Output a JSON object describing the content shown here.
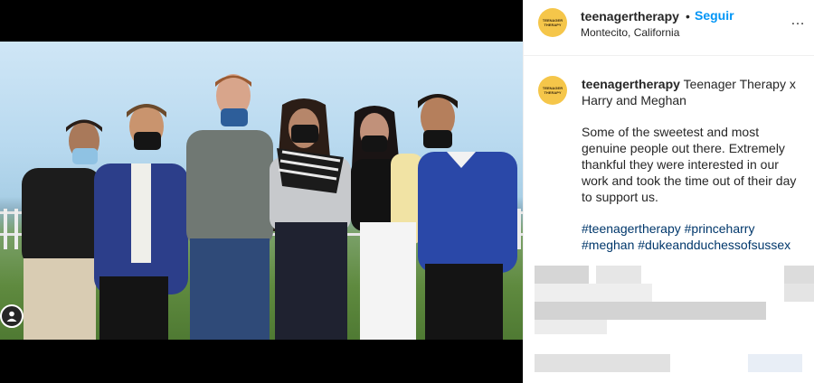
{
  "post": {
    "username": "teenagertherapy",
    "follow_separator": "•",
    "follow_label": "Seguir",
    "location": "Montecito, California",
    "more_icon": "…"
  },
  "avatar": {
    "text": "TEENAGER THERAPY",
    "color": "#f5c64a"
  },
  "caption": {
    "username": "teenagertherapy",
    "title": "Teenager Therapy x Harry and Meghan",
    "body": "Some of the sweetest and most genuine people out there. Extremely thankful they were interested in our work and took the time out of their day to support us.",
    "hashtags": "#teenagertherapy #princeharry #meghan #dukeandduchessofsussex"
  },
  "colors": {
    "follow": "#0095f6",
    "hashtag": "#00376b",
    "text": "#262626"
  },
  "icons": {
    "tag": "user-tag-icon",
    "more": "more-options-icon"
  }
}
